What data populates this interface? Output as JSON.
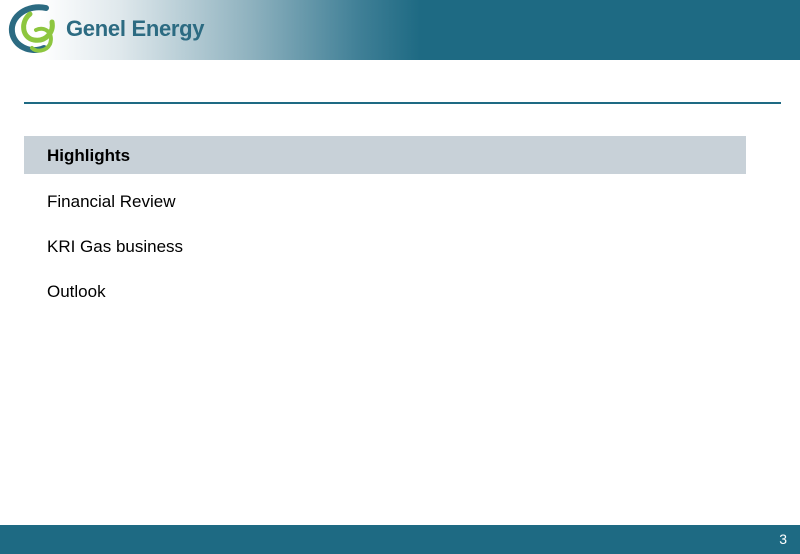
{
  "header": {
    "logo_text": "Genel Energy",
    "colors": {
      "band": "#1e6a83",
      "logo_green": "#8dc63f",
      "logo_blue": "#2c6b82"
    }
  },
  "agenda": {
    "items": [
      {
        "label": "Highlights",
        "active": true
      },
      {
        "label": "Financial Review",
        "active": false
      },
      {
        "label": "KRI Gas business",
        "active": false
      },
      {
        "label": "Outlook",
        "active": false
      }
    ],
    "highlight_color": "#c8d1d8"
  },
  "footer": {
    "page_number": "3"
  }
}
